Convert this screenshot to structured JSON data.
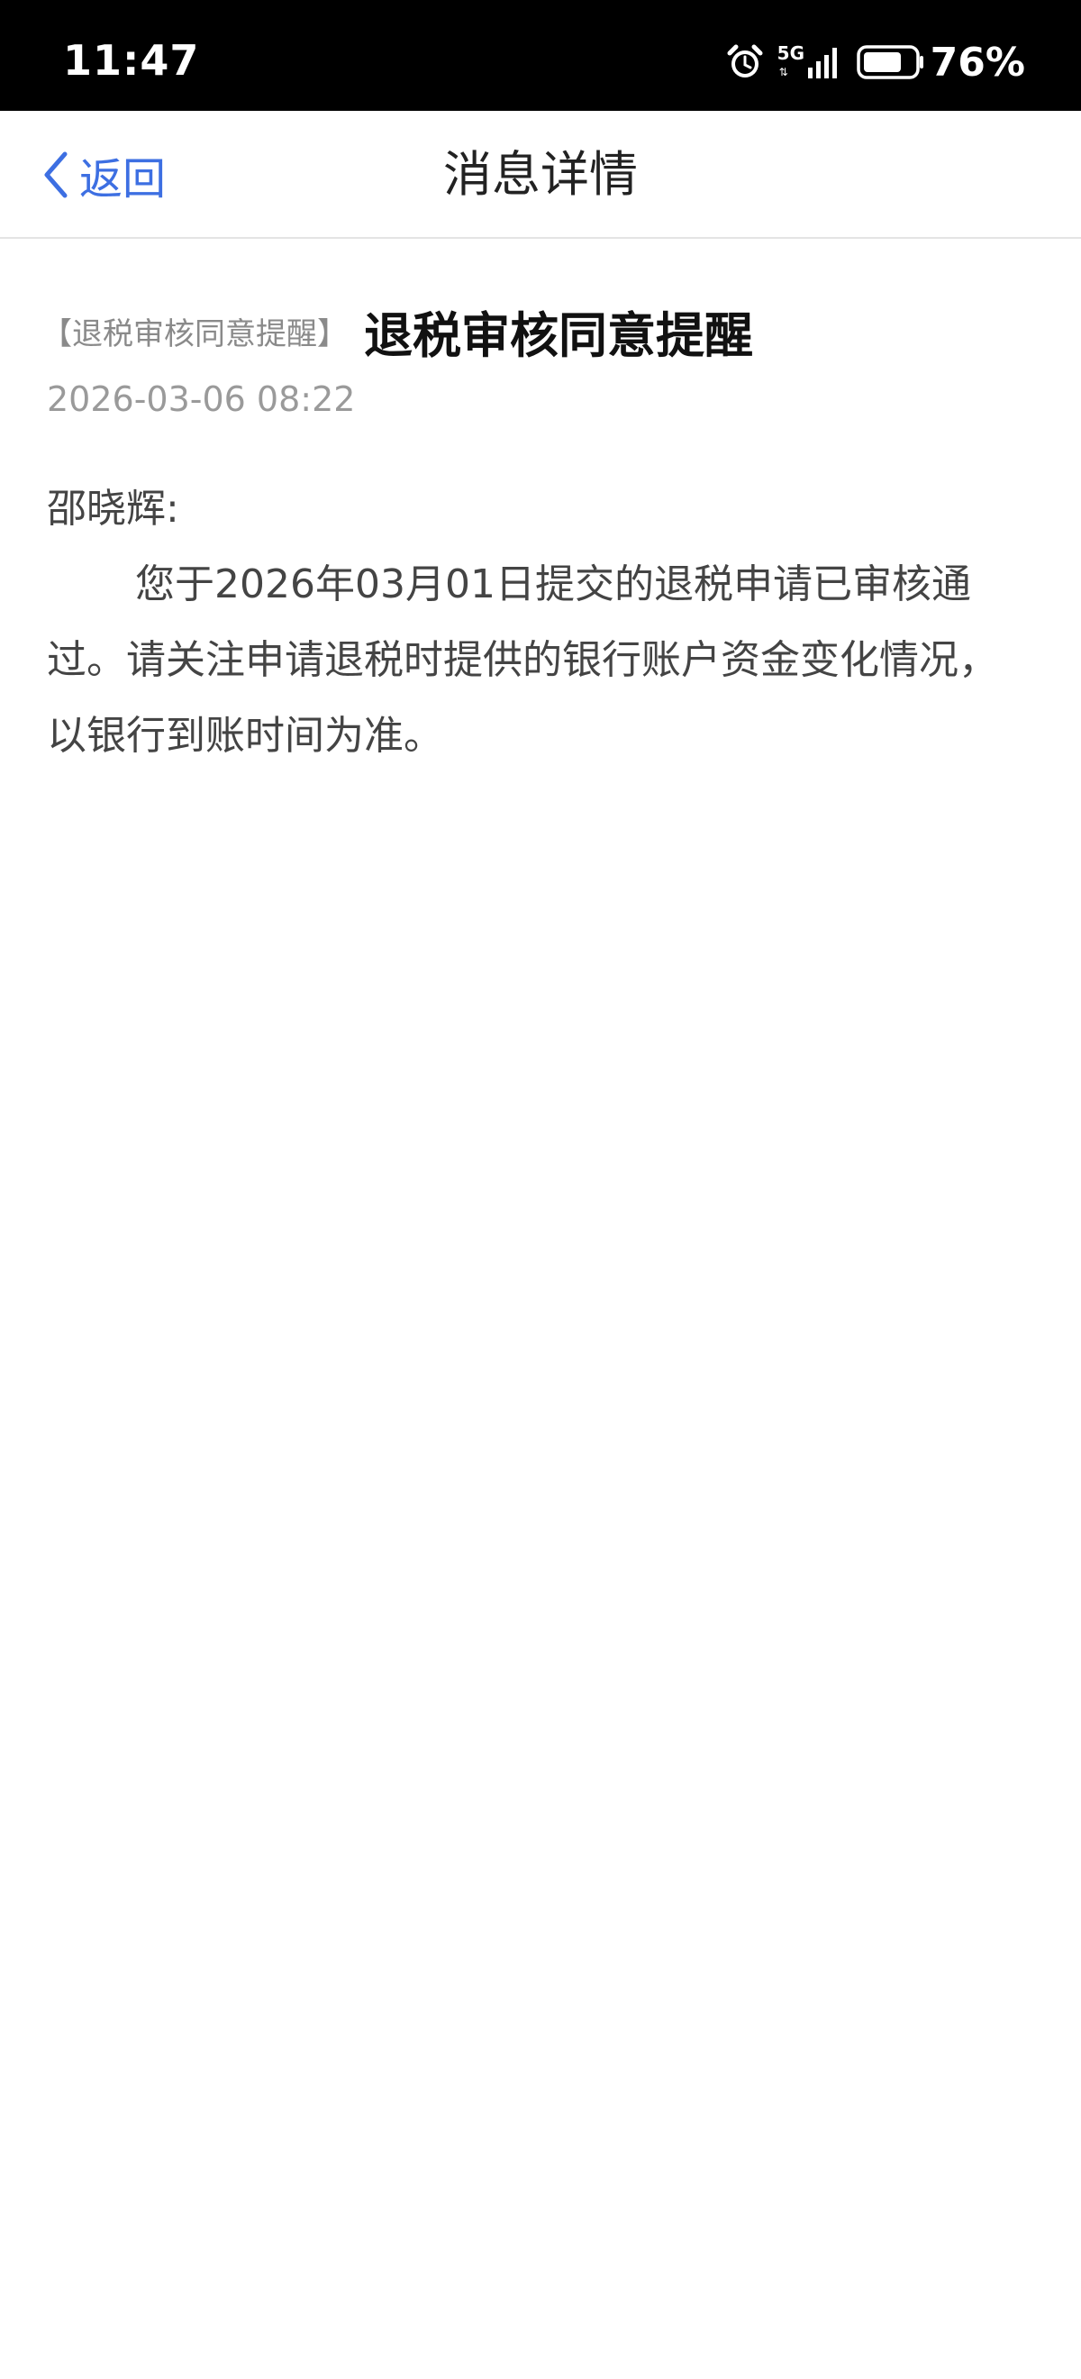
{
  "status_bar": {
    "time": "11:47",
    "network": "5G",
    "battery": "76%",
    "icons": [
      "alarm-icon",
      "signal-icon",
      "battery-icon"
    ],
    "battery_level": 0.76
  },
  "nav": {
    "back_label": "返回",
    "title": "消息详情",
    "accent_color": "#3d6fe2"
  },
  "message": {
    "tag": "【退税审核同意提醒】",
    "title": "退税审核同意提醒",
    "timestamp": "2026-03-06 08:22",
    "greeting": "邵晓辉:",
    "body": "您于2026年03月01日提交的退税申请已审核通过。请关注申请退税时提供的银行账户资金变化情况，以银行到账时间为准。"
  }
}
